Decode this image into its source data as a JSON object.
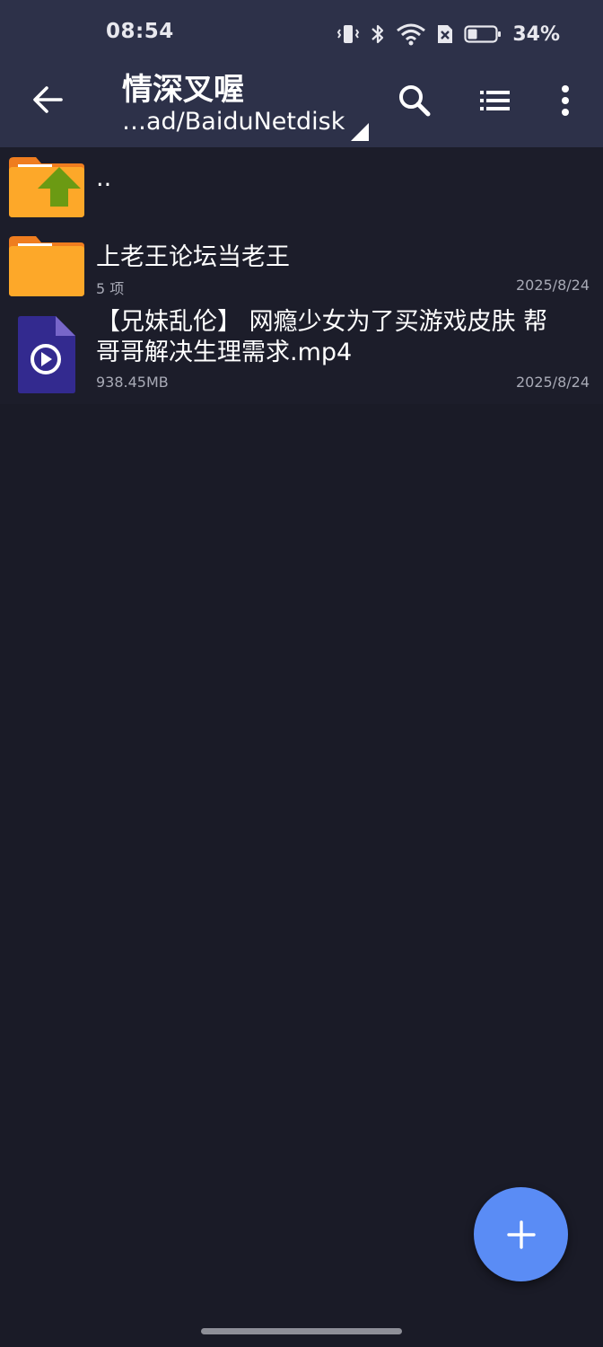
{
  "status_bar": {
    "time": "08:54",
    "battery_percent": "34%",
    "icons": [
      "vibrate-icon",
      "bluetooth-icon",
      "wifi-icon",
      "sim-off-icon",
      "battery-icon"
    ]
  },
  "app_bar": {
    "title": "情深叉喔",
    "path": "…ad/BaiduNetdisk",
    "actions": [
      "back-arrow-icon",
      "search-icon",
      "list-view-icon",
      "more-vert-icon"
    ]
  },
  "files": [
    {
      "name": "..",
      "type": "parent-folder"
    },
    {
      "name": "上老王论坛当老王",
      "type": "folder",
      "meta": "5 项",
      "date": "2025/8/24"
    },
    {
      "name_line1": "【兄妹乱伦】 网瘾少女为了买游戏皮肤 帮",
      "name_line2": "哥哥解决生理需求.mp4",
      "type": "video",
      "meta": "938.45MB",
      "date": "2025/8/24"
    }
  ],
  "fab": {
    "icon": "plus-icon"
  },
  "colors": {
    "header_bg": "#2d3149",
    "list_bg": "#1a1b27",
    "folder": "#fda829",
    "folder_tab": "#ef7d1f",
    "up_arrow": "#6b9a13",
    "video_file": "#332a8f",
    "fab": "#5a8cf5"
  }
}
